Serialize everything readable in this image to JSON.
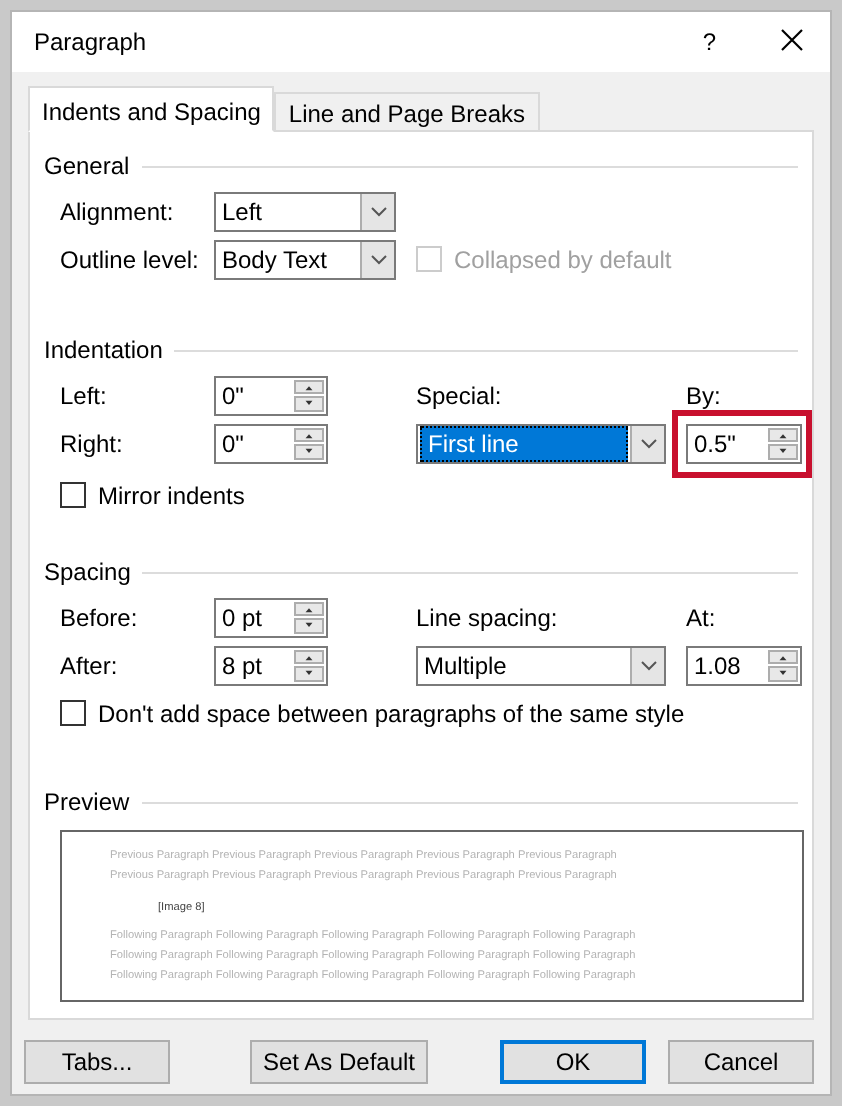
{
  "window": {
    "title": "Paragraph",
    "help": "?"
  },
  "tabs": [
    {
      "label": "Indents and Spacing",
      "selected": true
    },
    {
      "label": "Line and Page Breaks",
      "selected": false
    }
  ],
  "general": {
    "heading": "General",
    "alignment": {
      "label": "Alignment:",
      "value": "Left"
    },
    "outline_level": {
      "label": "Outline level:",
      "value": "Body Text"
    },
    "collapsed": {
      "label": "Collapsed by default",
      "checked": false,
      "disabled": true
    }
  },
  "indentation": {
    "heading": "Indentation",
    "left": {
      "label": "Left:",
      "value": "0\""
    },
    "right": {
      "label": "Right:",
      "value": "0\""
    },
    "special": {
      "label": "Special:",
      "value": "First line",
      "selected": true
    },
    "by": {
      "label": "By:",
      "value": "0.5\"",
      "highlighted": true
    },
    "mirror": {
      "label": "Mirror indents",
      "checked": false
    }
  },
  "spacing": {
    "heading": "Spacing",
    "before": {
      "label": "Before:",
      "value": "0 pt"
    },
    "after": {
      "label": "After:",
      "value": "8 pt"
    },
    "line_spacing": {
      "label": "Line spacing:",
      "value": "Multiple"
    },
    "at": {
      "label": "At:",
      "value": "1.08"
    },
    "dont_add": {
      "label": "Don't add space between paragraphs of the same style",
      "checked": false
    }
  },
  "preview": {
    "heading": "Preview",
    "previous_lines": [
      "Previous Paragraph Previous Paragraph Previous Paragraph Previous Paragraph Previous Paragraph",
      "Previous Paragraph Previous Paragraph Previous Paragraph Previous Paragraph Previous Paragraph"
    ],
    "image_label": "[Image 8]",
    "following_lines": [
      "Following Paragraph Following Paragraph Following Paragraph Following Paragraph Following Paragraph",
      "Following Paragraph Following Paragraph Following Paragraph Following Paragraph Following Paragraph",
      "Following Paragraph Following Paragraph Following Paragraph Following Paragraph Following Paragraph"
    ]
  },
  "buttons": [
    {
      "label": "Tabs...",
      "default": false
    },
    {
      "label": "Set As Default",
      "default": false
    },
    {
      "label": "OK",
      "default": true
    },
    {
      "label": "Cancel",
      "default": false
    }
  ]
}
